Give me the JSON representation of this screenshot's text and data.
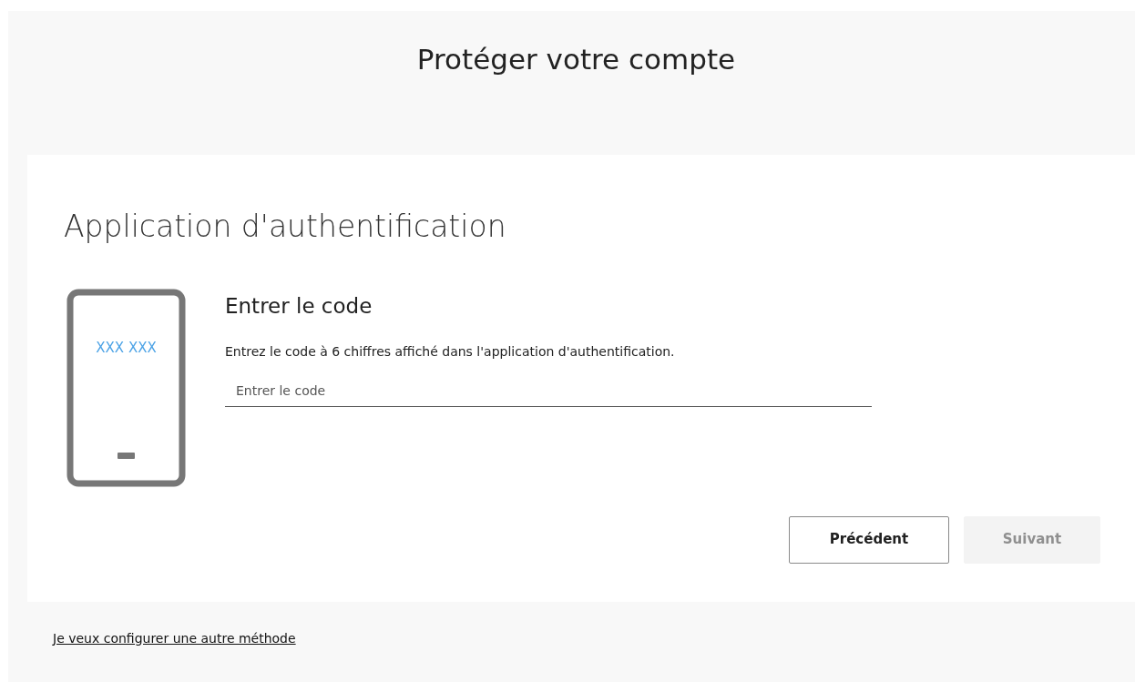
{
  "page_title": "Protéger votre compte",
  "card": {
    "title": "Application d'authentification",
    "phone_code": "XXX XXX",
    "heading": "Entrer le code",
    "description": "Entrez le code à 6 chiffres affiché dans l'application d'authentification.",
    "code_field": {
      "placeholder": "Entrer le code"
    },
    "buttons": [
      {
        "label": "Précédent",
        "disabled": false
      },
      {
        "label": "Suivant",
        "disabled": true
      }
    ]
  },
  "footer_link": "Je veux configurer une autre méthode"
}
